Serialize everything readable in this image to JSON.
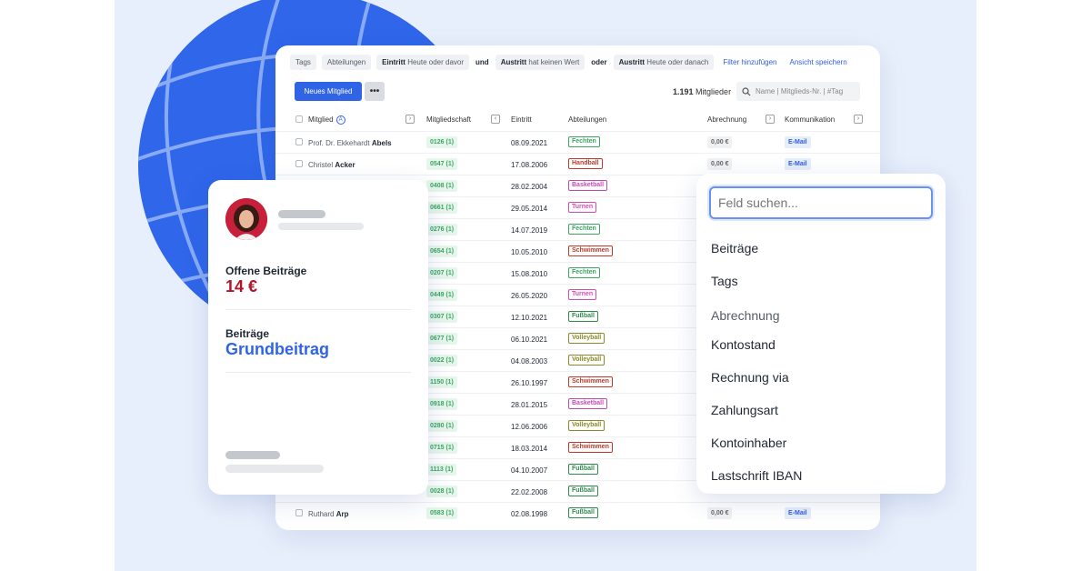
{
  "filters": {
    "tags": "Tags",
    "abteilungen": "Abteilungen",
    "eintritt_key": "Eintritt",
    "eintritt_val": "Heute oder davor",
    "und": "und",
    "austritt1_key": "Austritt",
    "austritt1_val": "hat keinen Wert",
    "oder": "oder",
    "austritt2_key": "Austritt",
    "austritt2_val": "Heute oder danach",
    "add_filter": "Filter hinzufügen",
    "save_view": "Ansicht speichern"
  },
  "toolbar": {
    "new_member": "Neues Mitglied",
    "more": "•••",
    "count": "1.191",
    "count_label": "Mitglieder",
    "search_placeholder": "Name | Mitglieds-Nr. | #Tag"
  },
  "columns": {
    "mitglied": "Mitglied",
    "mitgliedschaft": "Mitgliedschaft",
    "eintritt": "Eintritt",
    "abteilungen": "Abteilungen",
    "abrechnung": "Abrechnung",
    "kommunikation": "Kommunikation"
  },
  "rows": [
    {
      "first": "Prof. Dr. Ekkehardt",
      "last": "Abels",
      "nr": "0126 (1)",
      "date": "08.09.2021",
      "dept": "Fechten",
      "dept_color": "#3aa860",
      "amount": "0,00 €",
      "comm": "E-Mail"
    },
    {
      "first": "Christel",
      "last": "Acker",
      "nr": "0547 (1)",
      "date": "17.08.2006",
      "dept": "Handball",
      "dept_color": "#c0392b",
      "amount": "0,00 €",
      "comm": "E-Mail"
    },
    {
      "first": "",
      "last": "",
      "nr": "0408 (1)",
      "date": "28.02.2004",
      "dept": "Basketball",
      "dept_color": "#c548b8",
      "amount": "",
      "comm": ""
    },
    {
      "first": "",
      "last": "",
      "nr": "0661 (1)",
      "date": "29.05.2014",
      "dept": "Turnen",
      "dept_color": "#d64bb5",
      "amount": "",
      "comm": ""
    },
    {
      "first": "",
      "last": "",
      "nr": "0276 (1)",
      "date": "14.07.2019",
      "dept": "Fechten",
      "dept_color": "#3aa860",
      "amount": "",
      "comm": ""
    },
    {
      "first": "",
      "last": "",
      "nr": "0654 (1)",
      "date": "10.05.2010",
      "dept": "Schwimmen",
      "dept_color": "#c0392b",
      "amount": "",
      "comm": ""
    },
    {
      "first": "",
      "last": "",
      "nr": "0207 (1)",
      "date": "15.08.2010",
      "dept": "Fechten",
      "dept_color": "#3aa860",
      "amount": "",
      "comm": ""
    },
    {
      "first": "",
      "last": "",
      "nr": "0449 (1)",
      "date": "26.05.2020",
      "dept": "Turnen",
      "dept_color": "#d64bb5",
      "amount": "",
      "comm": ""
    },
    {
      "first": "",
      "last": "",
      "nr": "0307 (1)",
      "date": "12.10.2021",
      "dept": "Fußball",
      "dept_color": "#2f8a4e",
      "amount": "",
      "comm": ""
    },
    {
      "first": "",
      "last": "",
      "nr": "0677 (1)",
      "date": "06.10.2021",
      "dept": "Volleyball",
      "dept_color": "#8a8a2a",
      "amount": "",
      "comm": ""
    },
    {
      "first": "",
      "last": "",
      "nr": "0022 (1)",
      "date": "04.08.2003",
      "dept": "Volleyball",
      "dept_color": "#8a8a2a",
      "amount": "",
      "comm": ""
    },
    {
      "first": "",
      "last": "",
      "nr": "1150 (1)",
      "date": "26.10.1997",
      "dept": "Schwimmen",
      "dept_color": "#c0392b",
      "amount": "",
      "comm": ""
    },
    {
      "first": "",
      "last": "",
      "nr": "0918 (1)",
      "date": "28.01.2015",
      "dept": "Basketball",
      "dept_color": "#c548b8",
      "amount": "",
      "comm": ""
    },
    {
      "first": "",
      "last": "",
      "nr": "0280 (1)",
      "date": "12.06.2006",
      "dept": "Volleyball",
      "dept_color": "#8a8a2a",
      "amount": "",
      "comm": ""
    },
    {
      "first": "",
      "last": "",
      "nr": "0715 (1)",
      "date": "18.03.2014",
      "dept": "Schwimmen",
      "dept_color": "#c0392b",
      "amount": "",
      "comm": ""
    },
    {
      "first": "",
      "last": "",
      "nr": "1113 (1)",
      "date": "04.10.2007",
      "dept": "Fußball",
      "dept_color": "#2f8a4e",
      "amount": "",
      "comm": ""
    },
    {
      "first": "",
      "last": "",
      "nr": "0028 (1)",
      "date": "22.02.2008",
      "dept": "Fußball",
      "dept_color": "#2f8a4e",
      "amount": "",
      "comm": ""
    },
    {
      "first": "Ruthard",
      "last": "Arp",
      "nr": "0583 (1)",
      "date": "02.08.1998",
      "dept": "Fußball",
      "dept_color": "#2f8a4e",
      "amount": "0,00 €",
      "comm": "E-Mail"
    }
  ],
  "member_card": {
    "open_label": "Offene Beiträge",
    "open_value": "14 €",
    "contrib_label": "Beiträge",
    "contrib_value": "Grundbeitrag",
    "open_color": "#b3142a",
    "contrib_color": "#3064e6"
  },
  "field_panel": {
    "placeholder": "Feld suchen...",
    "options": [
      {
        "label": "Beiträge",
        "group": false
      },
      {
        "label": "Tags",
        "group": false
      },
      {
        "label": "Abrechnung",
        "group": true
      },
      {
        "label": "Kontostand",
        "group": false
      },
      {
        "label": "Rechnung via",
        "group": false
      },
      {
        "label": "Zahlungsart",
        "group": false
      },
      {
        "label": "Kontoinhaber",
        "group": false
      },
      {
        "label": "Lastschrift IBAN",
        "group": false
      }
    ]
  }
}
